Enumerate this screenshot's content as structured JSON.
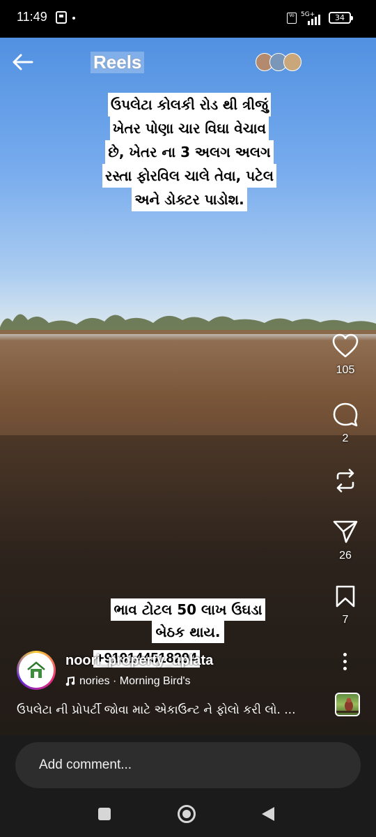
{
  "status_bar": {
    "time": "11:49",
    "network": "5G+",
    "battery": "34"
  },
  "header": {
    "title": "Reels"
  },
  "video_text": {
    "caption_lines": [
      "ઉપલેટા કોલકી રોડ થી ત્રીજું",
      "ખેતર પોણા ચાર વિઘા વેચાવ",
      "છે, ખેતર ના 3 અલગ અલગ",
      "રસ્તા ફોરવિલ ચાલે તેવા, પટેલ",
      "અને ડોક્ટર પાડોશ."
    ],
    "price_lines": [
      "ભાવ ટોટલ 50 લાખ ઉઘડા",
      "બેઠક થાય."
    ],
    "phone": "+919144518294"
  },
  "actions": {
    "likes": "105",
    "comments": "2",
    "shares": "26",
    "saves": "7"
  },
  "post": {
    "username": "noori_property_uplata",
    "audio": "nories · Morning Bird's",
    "description": "ઉપલેટા ની પ્રોપર્ટી જોવા માટે એકાઉન્ટ ને ફોલો કરી લો. ..."
  },
  "comment": {
    "placeholder": "Add comment..."
  },
  "colors": {
    "background": "#000000",
    "comment_bar": "#1b1b1b",
    "comment_input": "#2d2d2d"
  }
}
